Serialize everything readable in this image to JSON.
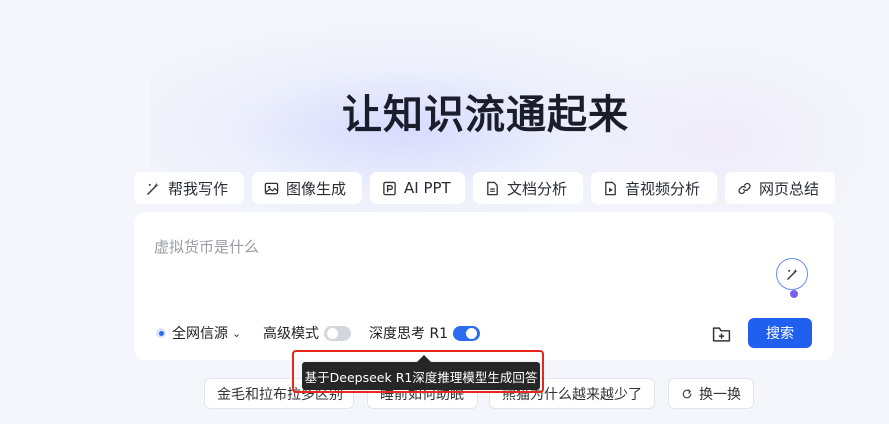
{
  "hero": {
    "title": "让知识流通起来"
  },
  "tools": [
    {
      "label": "帮我写作",
      "icon": "magic-wand-icon"
    },
    {
      "label": "图像生成",
      "icon": "image-icon"
    },
    {
      "label": "AI PPT",
      "icon": "ppt-icon"
    },
    {
      "label": "文档分析",
      "icon": "document-icon"
    },
    {
      "label": "音视频分析",
      "icon": "media-file-icon"
    },
    {
      "label": "网页总结",
      "icon": "link-icon"
    }
  ],
  "search": {
    "placeholder": "虚拟货币是什么",
    "source_label": "全网信源",
    "advanced_label": "高级模式",
    "advanced_enabled": false,
    "deep_think_label": "深度思考 R1",
    "deep_think_enabled": true,
    "submit_label": "搜索"
  },
  "tooltip": {
    "text": "基于Deepseek R1深度推理模型生成回答"
  },
  "suggestions": [
    {
      "label": "金毛和拉布拉多区别"
    },
    {
      "label": "睡前如何助眠"
    },
    {
      "label": "熊猫为什么越来越少了"
    }
  ],
  "refresh": {
    "label": "换一换"
  },
  "colors": {
    "accent": "#2060ee",
    "highlight_border": "#e8261c",
    "tooltip_bg": "#262626"
  }
}
